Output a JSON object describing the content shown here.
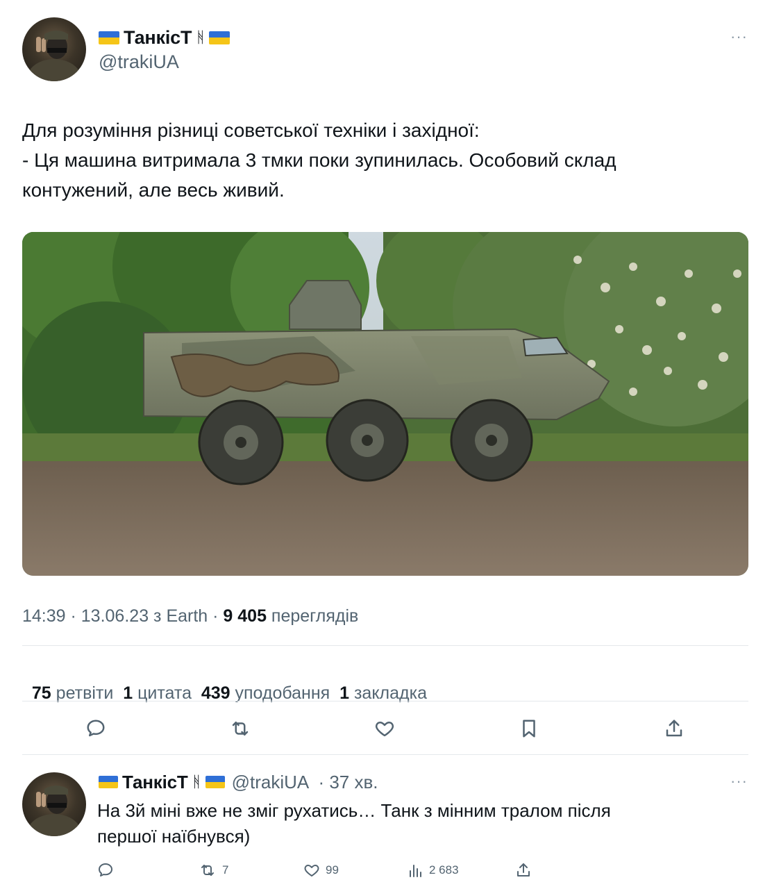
{
  "tweet": {
    "author_name": "ТанкісТ",
    "rune": "ᚻ",
    "author_handle": "@trakiUA",
    "more": "···",
    "text_lines": [
      "Для розуміння різниці советської техніки і західної:",
      "- Ця машина витримала 3 тмки поки зупинилась. Особовий склад",
      "контужений, але весь живий."
    ],
    "time": "14:39 · 13.06.23 з Earth · ",
    "views_count": "9 405",
    "views_label": " переглядів"
  },
  "stats": {
    "retweets_count": "75",
    "retweets_label": " ретвіти  ",
    "quotes_count": "1",
    "quotes_label": " цитата  ",
    "likes_count": "439",
    "likes_label": " уподобання  ",
    "bookmarks_count": "1",
    "bookmarks_label": " закладка"
  },
  "actions": {
    "icons": [
      "reply-icon",
      "retweet-icon",
      "like-icon",
      "bookmark-icon",
      "share-icon"
    ]
  },
  "reply": {
    "author_name": "ТанкісТ",
    "rune": "ᚻ",
    "author_handle": "@trakiUA",
    "time": " · 37 хв.",
    "more": "···",
    "text_lines": [
      "На 3й міні вже не зміг рухатись… Танк з мінним тралом після",
      "першої наїбнувся)"
    ],
    "retweets": "7",
    "likes": "99",
    "views": "2 683"
  },
  "colors": {
    "text": "#0f1419",
    "secondary": "#536471",
    "divider": "#e4e8eb",
    "flag_blue": "#2f6fd6",
    "flag_yellow": "#f5c518"
  }
}
